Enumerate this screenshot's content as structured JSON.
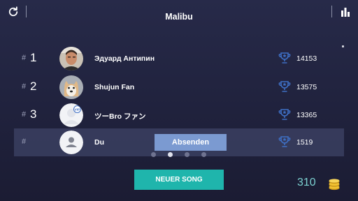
{
  "header": {
    "title": "Malibu"
  },
  "leaderboard": {
    "rows": [
      {
        "hash": "#",
        "rank": "1",
        "name": "Эдуард Антипин",
        "score": "14153",
        "avatar": "photo-man"
      },
      {
        "hash": "#",
        "rank": "2",
        "name": "Shujun Fan",
        "score": "13575",
        "avatar": "photo-dog"
      },
      {
        "hash": "#",
        "rank": "3",
        "name": "ツーBro ファン",
        "score": "13365",
        "avatar": "default-vip"
      },
      {
        "hash": "#",
        "rank": "",
        "name": "Du",
        "score": "1519",
        "avatar": "default-user",
        "highlighted": true
      }
    ]
  },
  "pager": {
    "pages": 4,
    "active_index": 1
  },
  "send_button": {
    "label": "Absenden"
  },
  "footer": {
    "new_song_label": "NEUER SONG",
    "coins": "310"
  },
  "icons": {
    "refresh": "refresh-icon",
    "stats": "bar-chart-icon",
    "trophy": "trophy-icon",
    "coin": "coin-stack-icon"
  },
  "colors": {
    "accent_teal": "#1fb5ac",
    "send_blue": "#7b9ad1",
    "trophy_blue": "#3e6fc4",
    "coin_gold": "#f1c232"
  }
}
